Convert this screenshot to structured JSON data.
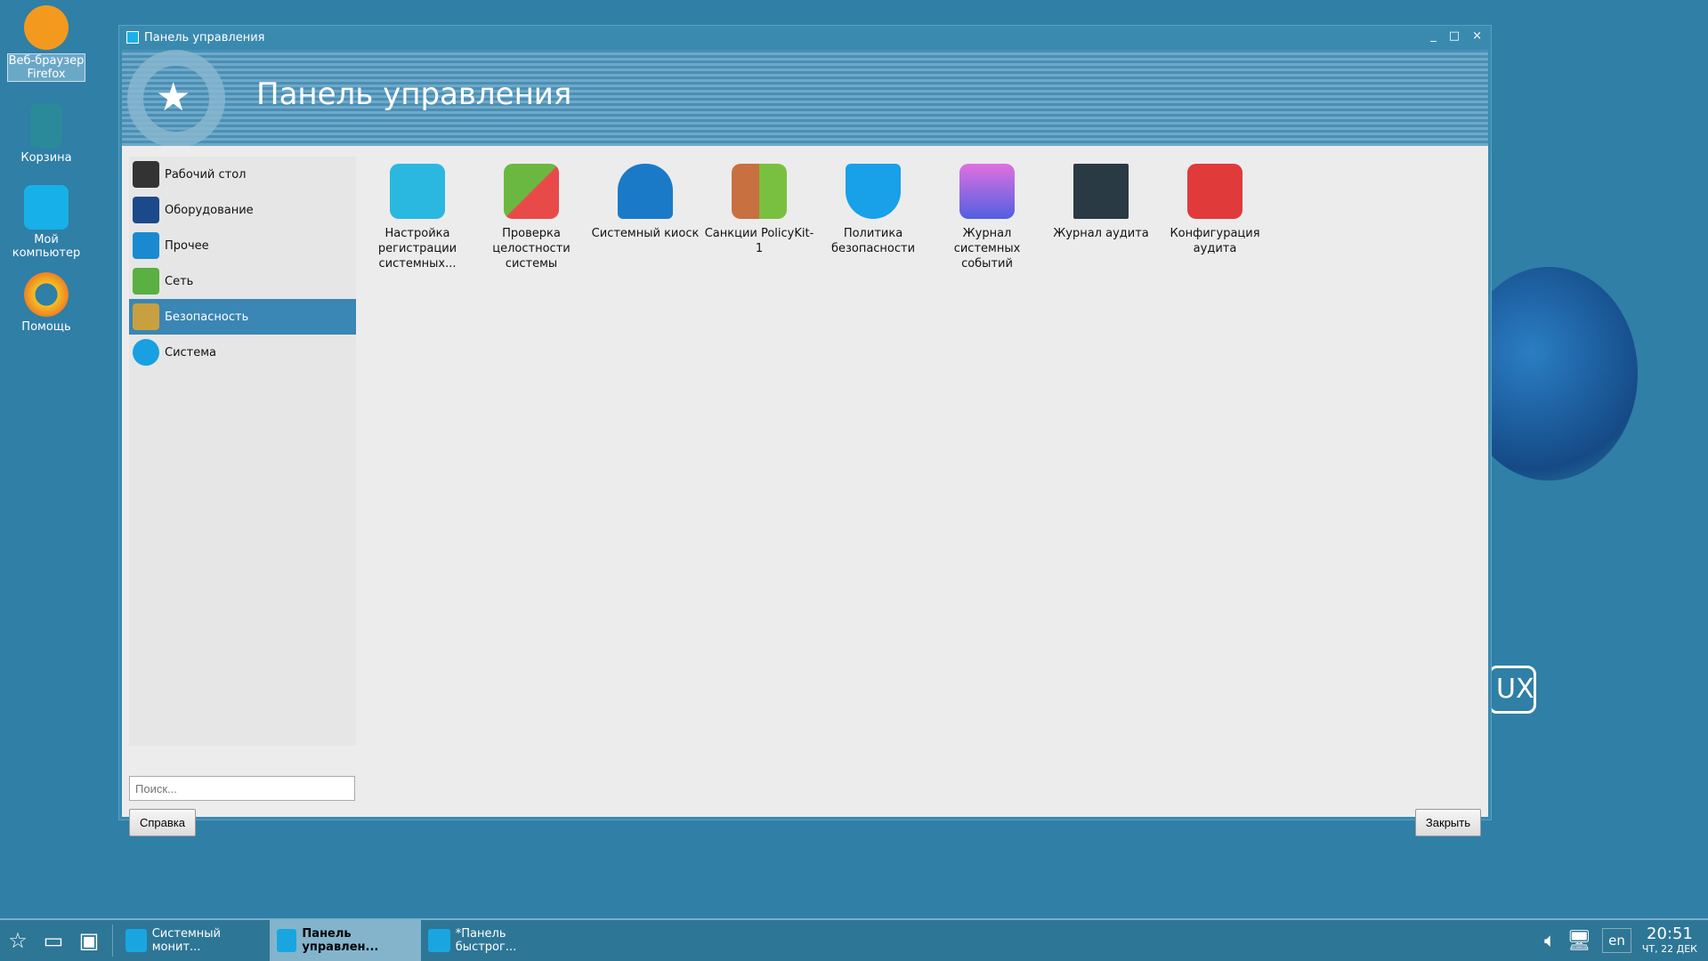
{
  "desktop": {
    "icons": [
      {
        "label": "Веб-браузер Firefox",
        "icon": "firefox-icon",
        "color": "#f39a1e"
      },
      {
        "label": "Корзина",
        "icon": "trash-icon",
        "color": "#2a8a9a"
      },
      {
        "label": "Мой компьютер",
        "icon": "computer-icon",
        "color": "#18b0e8"
      },
      {
        "label": "Помощь",
        "icon": "help-lifebuoy-icon",
        "color": "#f4c020"
      }
    ],
    "logo": "UX"
  },
  "window": {
    "title": "Панель управления",
    "banner_title": "Панель управления",
    "controls": {
      "minimize": "_",
      "maximize": "□",
      "close": "×"
    }
  },
  "sidebar": {
    "items": [
      {
        "label": "Рабочий стол",
        "color": "#333"
      },
      {
        "label": "Оборудование",
        "color": "#1a4a8a"
      },
      {
        "label": "Прочее",
        "color": "#1a8ad0"
      },
      {
        "label": "Сеть",
        "color": "#5ab040"
      },
      {
        "label": "Безопасность",
        "color": "#7ab0c8"
      },
      {
        "label": "Система",
        "color": "#18a0e0"
      }
    ],
    "selected": 4
  },
  "apps": [
    {
      "label": "Настройка регистрации системных...",
      "color": "#2ab8e0"
    },
    {
      "label": "Проверка целостности системы",
      "color": "#6ab840"
    },
    {
      "label": "Системный киоск",
      "color": "#1a7ac8"
    },
    {
      "label": "Санкции PolicyKit-1",
      "color": "#7ac040"
    },
    {
      "label": "Политика безопасности",
      "color": "#18a0e8"
    },
    {
      "label": "Журнал системных событий",
      "color": "#a070e0"
    },
    {
      "label": "Журнал аудита",
      "color": "#2a3a44"
    },
    {
      "label": "Конфигурация аудита",
      "color": "#e03a3a"
    }
  ],
  "search": {
    "placeholder": "Поиск..."
  },
  "buttons": {
    "help": "Справка",
    "close": "Закрыть"
  },
  "taskbar": {
    "tasks": [
      {
        "label": "Системный монит..."
      },
      {
        "label": "Панель управлен..."
      },
      {
        "label": "*Панель быстрог..."
      }
    ],
    "lang": "en",
    "time": "20:51",
    "date": "ЧТ, 22 ДЕК"
  }
}
